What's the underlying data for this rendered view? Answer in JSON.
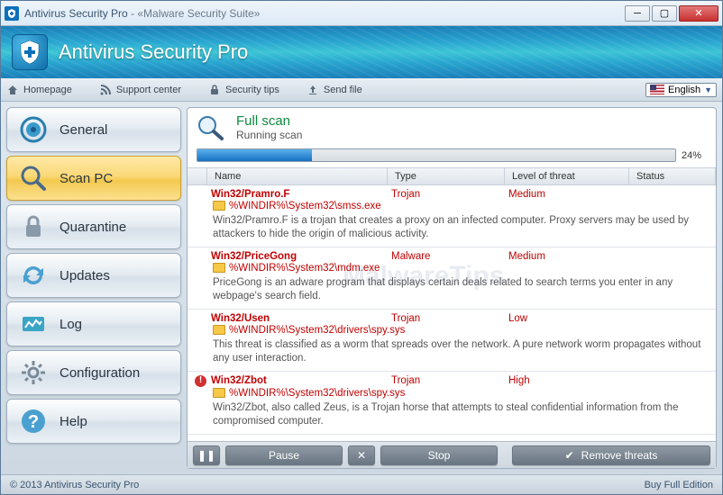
{
  "window": {
    "app_name": "Antivirus Security Pro",
    "subtitle": "- «Malware Security Suite»"
  },
  "banner": {
    "title": "Antivirus Security Pro"
  },
  "toolbar": {
    "homepage": "Homepage",
    "support": "Support center",
    "tips": "Security tips",
    "send": "Send file",
    "language": "English"
  },
  "sidebar": [
    {
      "label": "General"
    },
    {
      "label": "Scan PC"
    },
    {
      "label": "Quarantine"
    },
    {
      "label": "Updates"
    },
    {
      "label": "Log"
    },
    {
      "label": "Configuration"
    },
    {
      "label": "Help"
    }
  ],
  "scan": {
    "title": "Full scan",
    "status": "Running scan",
    "progress_pct": "24%"
  },
  "columns": {
    "name": "Name",
    "type": "Type",
    "level": "Level of threat",
    "status": "Status"
  },
  "threats": [
    {
      "name": "Win32/Pramro.F",
      "type": "Trojan",
      "level": "Medium",
      "path": "%WINDIR%\\System32\\smss.exe",
      "desc": "Win32/Pramro.F is a trojan that creates a proxy on an infected computer. Proxy servers may be used by attackers to hide the origin of malicious activity.",
      "marker": "folder"
    },
    {
      "name": "Win32/PriceGong",
      "type": "Malware",
      "level": "Medium",
      "path": "%WINDIR%\\System32\\mdm.exe",
      "desc": "PriceGong is an adware program that displays certain deals related to search terms you enter in any webpage's search field.",
      "marker": "folder"
    },
    {
      "name": "Win32/Usen",
      "type": "Trojan",
      "level": "Low",
      "path": "%WINDIR%\\System32\\drivers\\spy.sys",
      "desc": "This threat is classified as a worm that spreads over the network. A pure network worm propagates without any user interaction.",
      "marker": "folder"
    },
    {
      "name": "Win32/Zbot",
      "type": "Trojan",
      "level": "High",
      "path": "%WINDIR%\\System32\\drivers\\spy.sys",
      "desc": "Win32/Zbot, also called Zeus, is a Trojan horse that attempts to steal confidential information from the compromised computer.",
      "marker": "alert"
    }
  ],
  "actions": {
    "pause": "Pause",
    "stop": "Stop",
    "remove": "Remove threats"
  },
  "footer": {
    "copyright": "© 2013 Antivirus Security Pro",
    "buy": "Buy Full Edition"
  },
  "watermark": "MalwareTips"
}
